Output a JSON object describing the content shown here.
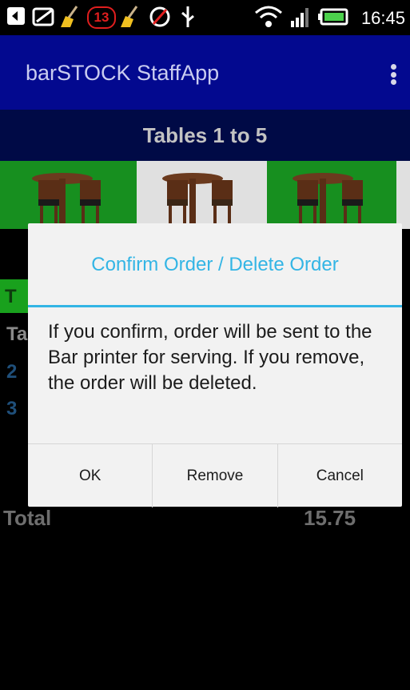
{
  "status_bar": {
    "time": "16:45",
    "notification_count": "13",
    "icons": [
      "back-arrow-icon",
      "image-icon",
      "broom-icon",
      "notification-badge-icon",
      "broom-icon",
      "slash-icon",
      "usb-icon",
      "wifi-icon",
      "signal-icon",
      "battery-icon"
    ]
  },
  "action_bar": {
    "title": "barSTOCK StaffApp",
    "overflow_icon": "overflow-menu-icon"
  },
  "tables": {
    "header": "Tables 1 to 5",
    "colors": {
      "green": "#178f1f",
      "gray": "#e0e0e0"
    }
  },
  "background": {
    "row1_fragment": "T",
    "row2_fragment": "Ta",
    "row3_fragment": "2",
    "row4_fragment": "3",
    "total_label": "Total",
    "total_value": "15.75"
  },
  "dialog": {
    "title": "Confirm Order / Delete Order",
    "message": "If you confirm, order will be sent to the Bar printer for serving. If you remove, the order will be deleted.",
    "buttons": {
      "ok": "OK",
      "remove": "Remove",
      "cancel": "Cancel"
    }
  },
  "colors": {
    "accent": "#33b5e5",
    "action_bar": "#03098f",
    "header": "#000a46"
  }
}
